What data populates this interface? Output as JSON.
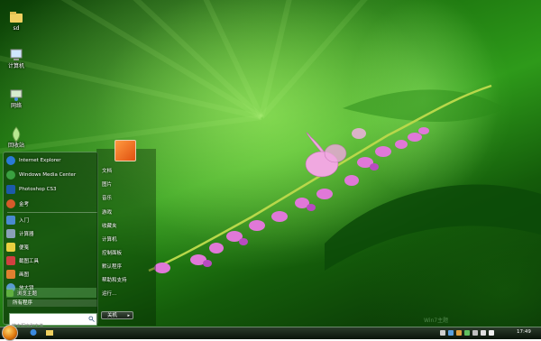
{
  "desktop": {
    "icons": [
      {
        "label": "sd",
        "icon": "user-folder-icon"
      },
      {
        "label": "计算机",
        "icon": "computer-icon"
      },
      {
        "label": "网络",
        "icon": "network-icon"
      },
      {
        "label": "回收站",
        "icon": "recycle-bin-icon"
      }
    ]
  },
  "start_menu": {
    "programs": [
      {
        "label": "Internet Explorer",
        "icon": "internet-explorer-icon",
        "color": "#2a7ad6"
      },
      {
        "label": "Windows Media Center",
        "icon": "media-center-icon",
        "color": "#3aa040"
      },
      {
        "label": "Photoshop CS3",
        "icon": "photoshop-icon",
        "color": "#1c5aa8"
      },
      {
        "label": "金考",
        "icon": "app-icon",
        "color": "#d65a2a"
      },
      {
        "label": "入门",
        "icon": "getting-started-icon",
        "color": "#4a8ad0"
      },
      {
        "label": "计算器",
        "icon": "calculator-icon",
        "color": "#8aa0b8"
      },
      {
        "label": "便笺",
        "icon": "sticky-notes-icon",
        "color": "#e8d040"
      },
      {
        "label": "截图工具",
        "icon": "snipping-tool-icon",
        "color": "#d04040"
      },
      {
        "label": "画图",
        "icon": "paint-icon",
        "color": "#e08030"
      },
      {
        "label": "放大镜",
        "icon": "magnifier-icon",
        "color": "#5a9ad0"
      },
      {
        "label": "浏览主题",
        "icon": "theme-icon",
        "color": "#60b040"
      }
    ],
    "all_programs": "所有程序",
    "search_placeholder": "搜索程序和文件",
    "right_links": [
      "文档",
      "图片",
      "音乐",
      "游戏",
      "收藏夹",
      "计算机",
      "控制面板",
      "默认程序",
      "帮助和支持",
      "运行..."
    ],
    "shutdown_label": "关机"
  },
  "taskbar": {
    "clock": "17:49",
    "watermark": "Win7主题"
  },
  "colors": {
    "accent": "#2e9a1a",
    "orb": "#e07a10"
  }
}
